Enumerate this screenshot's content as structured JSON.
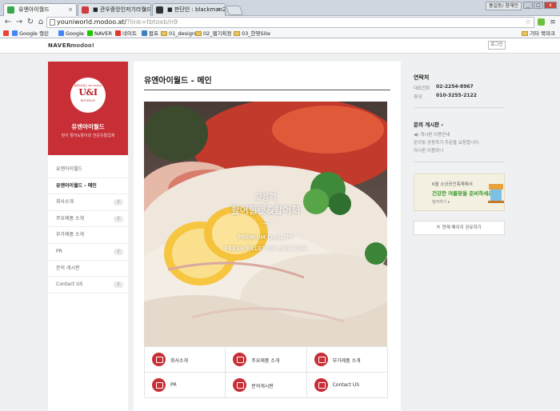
{
  "browser": {
    "tabs": [
      {
        "title": "유엔아이월드",
        "favicon_color": "#39a74c"
      },
      {
        "title": "■ 관우중앙인저기라월드",
        "favicon_color": "#d23b3b"
      },
      {
        "title": "■ 판단인 : blackman28 po",
        "favicon_color": "#333333"
      }
    ],
    "window_buttons": {
      "min": "_",
      "max": "□",
      "close": "x"
    },
    "user_label": "홍길동/ 참해인",
    "url_host": "youniworld.modoo.at/",
    "url_path": "?link=tbtoxb/n9",
    "bookmarks": [
      "Google 캘린",
      "Google",
      "NAVER",
      "네이트",
      "팝프",
      "01_design",
      "02_웹기획정",
      "03_한영Site"
    ],
    "other_bookmarks": "기타 북마크"
  },
  "topbar": {
    "naver": "NAVER",
    "modoo": "modoo!",
    "login": "로그인"
  },
  "sidebar": {
    "logo_small": "유엔아이월드 UNI WORLD",
    "logo_main": "U&I",
    "logo_sub": "WORLD",
    "brand_name": "유엔아이월드",
    "brand_desc": "횟아 활어&활어회 전문유통업체",
    "menu": [
      {
        "label": "유엔아이월드",
        "badge": ""
      },
      {
        "label": "유엔아이월드 - 메인",
        "badge": ""
      },
      {
        "label": "회사소개",
        "badge": "3"
      },
      {
        "label": "주요제품 소개",
        "badge": "3"
      },
      {
        "label": "부가제품 소개",
        "badge": ""
      },
      {
        "label": "PR",
        "badge": "2"
      },
      {
        "label": "문의 게시판",
        "badge": ""
      },
      {
        "label": "Contact US",
        "badge": "2"
      }
    ]
  },
  "main": {
    "title": "유엔아이월드 - 메인",
    "hero": {
      "ko1": "고품격",
      "ko2": "활어필렛&활어회",
      "dash": "—",
      "en1": "PREMIUM QUALITY",
      "en2": "FRESH FILLET OF LIVE FISH"
    },
    "quick_links": [
      "회사소개",
      "주요제품 소개",
      "부가제품 소개",
      "PR",
      "문의게시판",
      "Contact US"
    ]
  },
  "right": {
    "contact_title": "연락처",
    "phone_label": "대표전화",
    "phone": "02-2254-8967",
    "mobile_label": "휴대",
    "mobile": "010-3255-2122",
    "board_title": "문의 게시판 ›",
    "board_lines": [
      "◀) 게시판 이용안내",
      "문의및 공동하기 주문을 요청합니다.",
      "자시판 이용하니"
    ],
    "banner_line1": "6월 소상공인축제에서",
    "banner_line2": "건강한 여름맞을 준비하세요",
    "banner_line3": "참여하기 ▸",
    "share": "현재 페이지 공유하기"
  },
  "colors": {
    "brand_red": "#c72e36",
    "banner_green": "#3a9a2c"
  }
}
